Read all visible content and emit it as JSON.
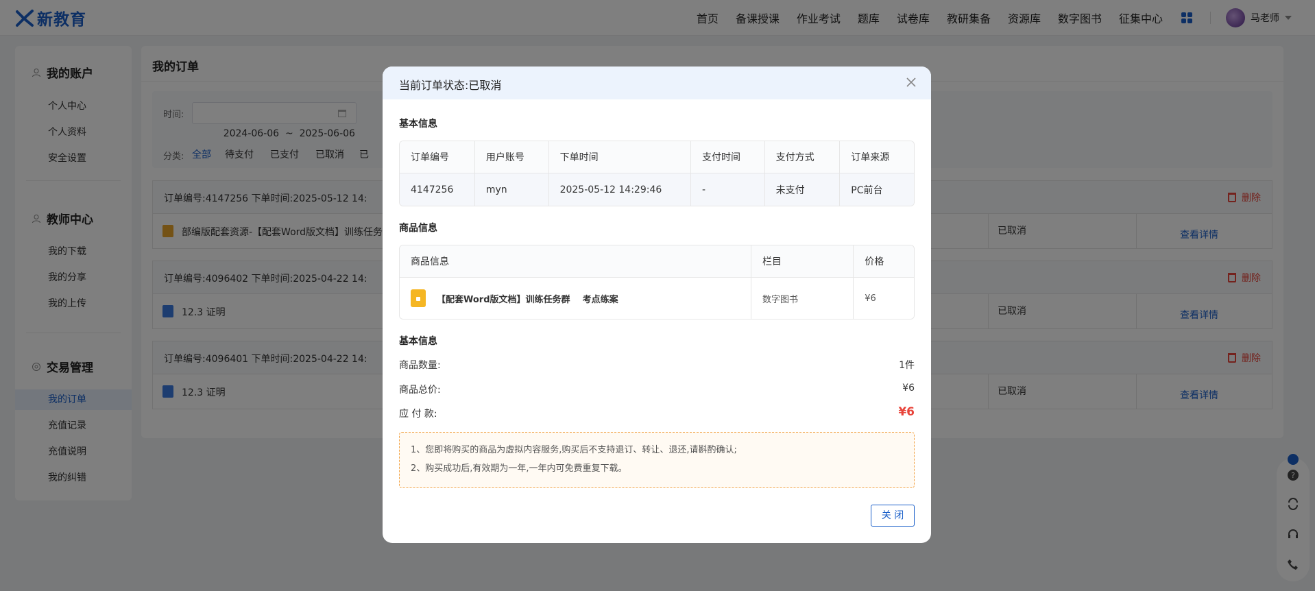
{
  "brand": {
    "name": "新教育",
    "accent": "#1a5fc9",
    "danger": "#e8443a"
  },
  "nav": {
    "items": [
      "首页",
      "备课授课",
      "作业考试",
      "题库",
      "试卷库",
      "教研集备",
      "资源库",
      "数字图书",
      "征集中心"
    ],
    "apps_icon": "grid-apps-icon",
    "user": "马老师"
  },
  "sidebar": {
    "groups": [
      {
        "title": "我的账户",
        "icon": "user-icon",
        "items": [
          "个人中心",
          "个人资料",
          "安全设置"
        ]
      },
      {
        "title": "教师中心",
        "icon": "teacher-icon",
        "items": [
          "我的下载",
          "我的分享",
          "我的上传"
        ]
      },
      {
        "title": "交易管理",
        "icon": "trade-icon",
        "items": [
          "我的订单",
          "充值记录",
          "充值说明",
          "我的纠错"
        ]
      }
    ],
    "active": "我的订单"
  },
  "main": {
    "title": "我的订单",
    "filter": {
      "time_label": "时间:",
      "date_range": "2024-06-06  ~  2025-06-06",
      "category_label": "分类:",
      "categories": [
        "全部",
        "待支付",
        "已支付",
        "已取消",
        "已"
      ],
      "active_category": "全部"
    },
    "orders": [
      {
        "head": "订单编号:4147256    下单时间:2025-05-12 14:",
        "delete": "删除",
        "name": "部编版配套资源-【配套Word版文档】训练任务",
        "status": "已取消",
        "detail": "查看详情",
        "icon": "book-icon"
      },
      {
        "head": "订单编号:4096402    下单时间:2025-04-22 14:",
        "delete": "删除",
        "name": "12.3 证明",
        "status": "已取消",
        "detail": "查看详情",
        "icon": "doc-icon"
      },
      {
        "head": "订单编号:4096401    下单时间:2025-04-22 14:",
        "delete": "删除",
        "name": "12.3 证明",
        "status": "已取消",
        "detail": "查看详情",
        "icon": "doc-icon"
      }
    ]
  },
  "dialog": {
    "title": "当前订单状态:已取消",
    "basic_title": "基本信息",
    "basic_headers": [
      "订单编号",
      "用户账号",
      "下单时间",
      "支付时间",
      "支付方式",
      "订单来源"
    ],
    "basic_values": [
      "4147256",
      "myn",
      "2025-05-12 14:29:46",
      "-",
      "未支付",
      "PC前台"
    ],
    "goods_title": "商品信息",
    "goods_headers": [
      "商品信息",
      "栏目",
      "价格"
    ],
    "goods_row": {
      "name": "【配套Word版文档】训练任务群    考点练案",
      "column": "数字图书",
      "price": "¥6"
    },
    "summary_title": "基本信息",
    "summary": [
      {
        "label": "商品数量:",
        "value": "1件"
      },
      {
        "label": "商品总价:",
        "value": "¥6"
      },
      {
        "label": "应 付 款:",
        "value": "¥6"
      }
    ],
    "notice": [
      "1、您即将购买的商品为虚拟内容服务,购买后不支持退订、转让、退还,请斟酌确认;",
      "2、购买成功后,有效期为一年,一年内可免费重复下载。"
    ],
    "close_button": "关 闭"
  },
  "float_toolbar": [
    "help-icon",
    "refresh-icon",
    "headset-icon",
    "phone-icon"
  ]
}
